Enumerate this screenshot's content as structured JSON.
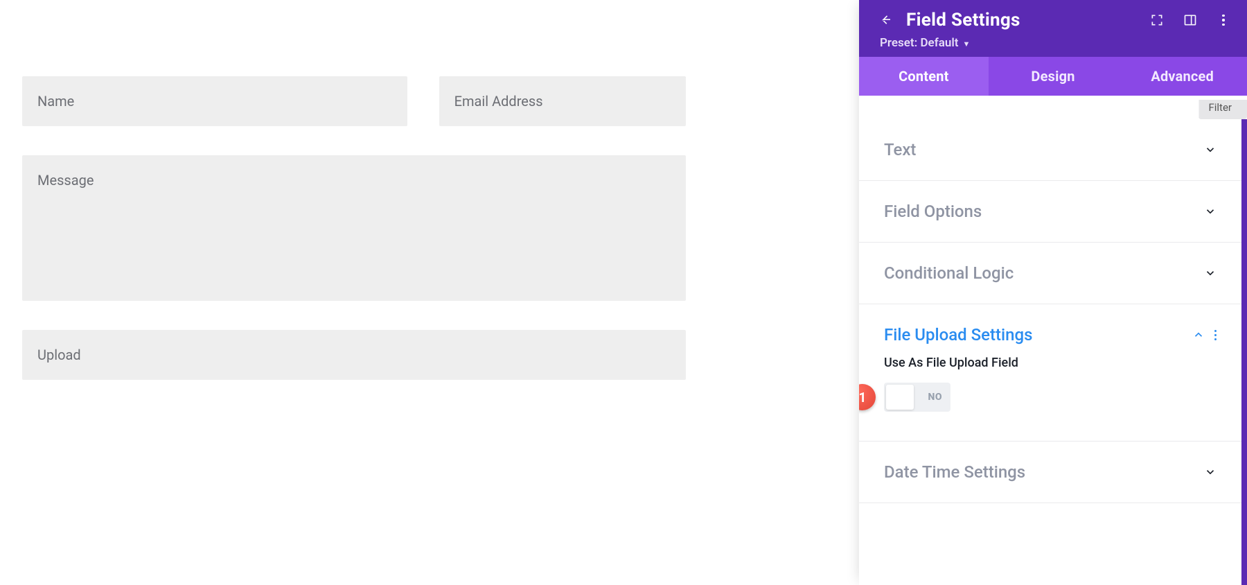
{
  "form": {
    "fields": {
      "name": {
        "placeholder": "Name"
      },
      "email": {
        "placeholder": "Email Address"
      },
      "message": {
        "placeholder": "Message"
      },
      "upload": {
        "placeholder": "Upload"
      }
    }
  },
  "panel": {
    "title": "Field Settings",
    "preset_label": "Preset: Default",
    "tabs": {
      "content": "Content",
      "design": "Design",
      "advanced": "Advanced",
      "active": "content"
    },
    "filter_button": "Filter",
    "sections": {
      "text": {
        "label": "Text",
        "expanded": false
      },
      "field_options": {
        "label": "Field Options",
        "expanded": false
      },
      "conditional": {
        "label": "Conditional Logic",
        "expanded": false
      },
      "file_upload": {
        "label": "File Upload Settings",
        "expanded": true
      },
      "date_time": {
        "label": "Date Time Settings",
        "expanded": false
      }
    },
    "file_upload": {
      "option_label": "Use As File Upload Field",
      "toggle_state": "NO"
    }
  },
  "callout_number": "1"
}
